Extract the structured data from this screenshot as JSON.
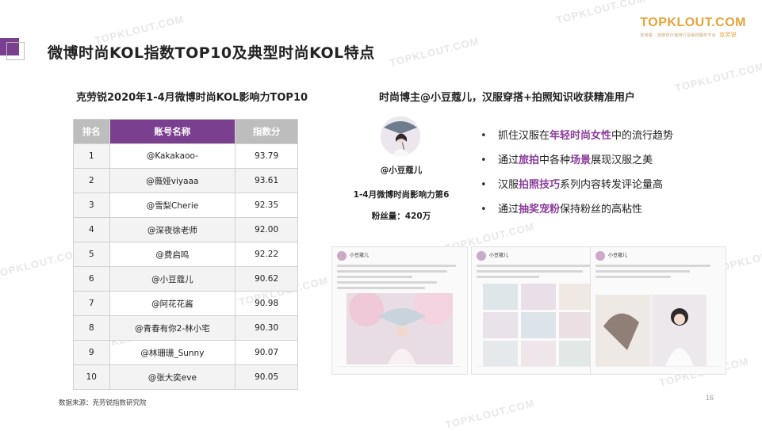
{
  "watermark": "TOPKLOUT.COM",
  "brand": {
    "logo": "TOPKLOUT.COM",
    "tagline": "克劳锐 · 自媒体价值排行及版权服务平台",
    "name": "克劳锐"
  },
  "title": "微博时尚KOL指数TOP10及典型时尚KOL特点",
  "table": {
    "title": "克劳锐2020年1-4月微博时尚KOL影响力TOP10",
    "headers": [
      "排名",
      "账号名称",
      "指数分"
    ],
    "rows": [
      {
        "rank": "1",
        "name": "@Kakakaoo-",
        "score": "93.79"
      },
      {
        "rank": "2",
        "name": "@薇娅viyaaa",
        "score": "93.61"
      },
      {
        "rank": "3",
        "name": "@雪梨Cherie",
        "score": "92.35"
      },
      {
        "rank": "4",
        "name": "@深夜徐老师",
        "score": "92.00"
      },
      {
        "rank": "5",
        "name": "@费启鸣",
        "score": "92.22"
      },
      {
        "rank": "6",
        "name": "@小豆蔻儿",
        "score": "90.62"
      },
      {
        "rank": "7",
        "name": "@阿花花酱",
        "score": "90.98"
      },
      {
        "rank": "8",
        "name": "@青春有你2-林小宅",
        "score": "90.30"
      },
      {
        "rank": "9",
        "name": "@林珊珊_Sunny",
        "score": "90.07"
      },
      {
        "rank": "10",
        "name": "@张大奕eve",
        "score": "90.05"
      }
    ]
  },
  "profile": {
    "title": "时尚博主@小豆蔻儿，汉服穿搭+拍照知识收获精准用户",
    "name": "@小豆蔻儿",
    "rank_text": "1-4月微博时尚影响力第6",
    "fans_text": "粉丝量：420万"
  },
  "points": [
    [
      {
        "t": "抓住汉服在"
      },
      {
        "t": "年轻时尚女性",
        "h": true
      },
      {
        "t": "中的流行趋势"
      }
    ],
    [
      {
        "t": "通过"
      },
      {
        "t": "旅拍",
        "h": true
      },
      {
        "t": "中各种"
      },
      {
        "t": "场景",
        "h": true
      },
      {
        "t": "展现汉服之美"
      }
    ],
    [
      {
        "t": "汉服"
      },
      {
        "t": "拍照技巧",
        "h": true
      },
      {
        "t": "系列内容转发评论量高"
      }
    ],
    [
      {
        "t": "通过"
      },
      {
        "t": "抽奖宠粉",
        "h": true
      },
      {
        "t": "保持粉丝的高粘性"
      }
    ]
  ],
  "screenshots": [
    {
      "user": "小豆蔻儿"
    },
    {
      "user": "小豆蔻儿"
    },
    {
      "user": "小豆蔻儿"
    }
  ],
  "colors": {
    "accent": "#7a3f8f",
    "highlight": "#8b3f9a",
    "logo": "#e8a33a"
  },
  "source": "数据来源：克劳锐指数研究院",
  "page_number": "16"
}
